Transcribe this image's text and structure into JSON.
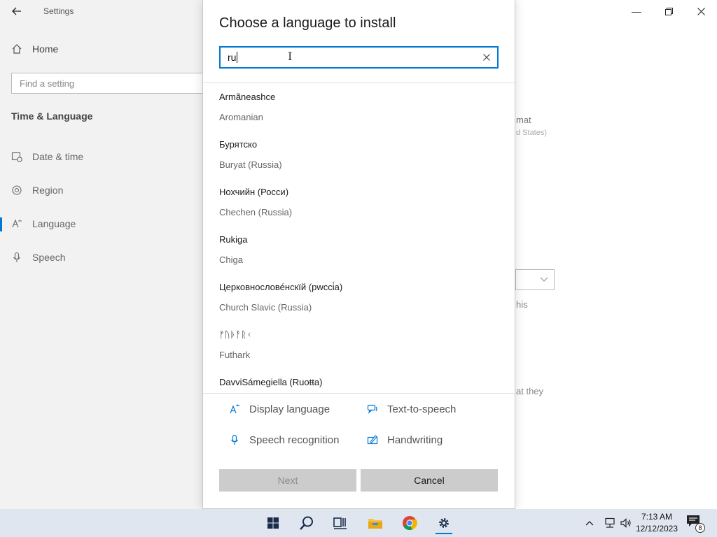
{
  "settings_window": {
    "app_title": "Settings",
    "home_label": "Home",
    "search_placeholder": "Find a setting",
    "section_title": "Time & Language",
    "nav_items": [
      {
        "label": "Date & time",
        "icon": "calendar-clock-icon"
      },
      {
        "label": "Region",
        "icon": "globe-icon"
      },
      {
        "label": "Language",
        "icon": "language-icon",
        "selected": true
      },
      {
        "label": "Speech",
        "icon": "microphone-icon"
      }
    ],
    "background_text": {
      "format_fragment": "mat",
      "states_fragment": "d States)",
      "this_fragment": "his",
      "they_fragment": "at they"
    }
  },
  "dialog": {
    "title": "Choose a language to install",
    "search_value": "ru",
    "languages": [
      {
        "native": "Armãneashce",
        "english": "Aromanian"
      },
      {
        "native": "Бурятско",
        "english": "Buryat (Russia)"
      },
      {
        "native": "Нохчийн (Росси)",
        "english": "Chechen (Russia)"
      },
      {
        "native": "Rukiga",
        "english": "Chiga"
      },
      {
        "native": "Церковнослове́нскїй (рwссі́а)",
        "english": "Church Slavic (Russia)"
      },
      {
        "native": "ᚠᚢᚦᚨᚱᚲ",
        "english": "Futhark"
      },
      {
        "native": "DavviSámegiella (Ruoŧŧa)",
        "english": ""
      }
    ],
    "features": {
      "display_language": "Display language",
      "text_to_speech": "Text-to-speech",
      "speech_recognition": "Speech recognition",
      "handwriting": "Handwriting"
    },
    "next_label": "Next",
    "cancel_label": "Cancel"
  },
  "taskbar": {
    "time": "7:13 AM",
    "date": "12/12/2023",
    "notification_count": "8"
  },
  "colors": {
    "accent": "#0078d4",
    "sidebar_bg": "#f2f2f2",
    "button_bg": "#cccccc",
    "taskbar_bg": "#dfe6f0"
  }
}
